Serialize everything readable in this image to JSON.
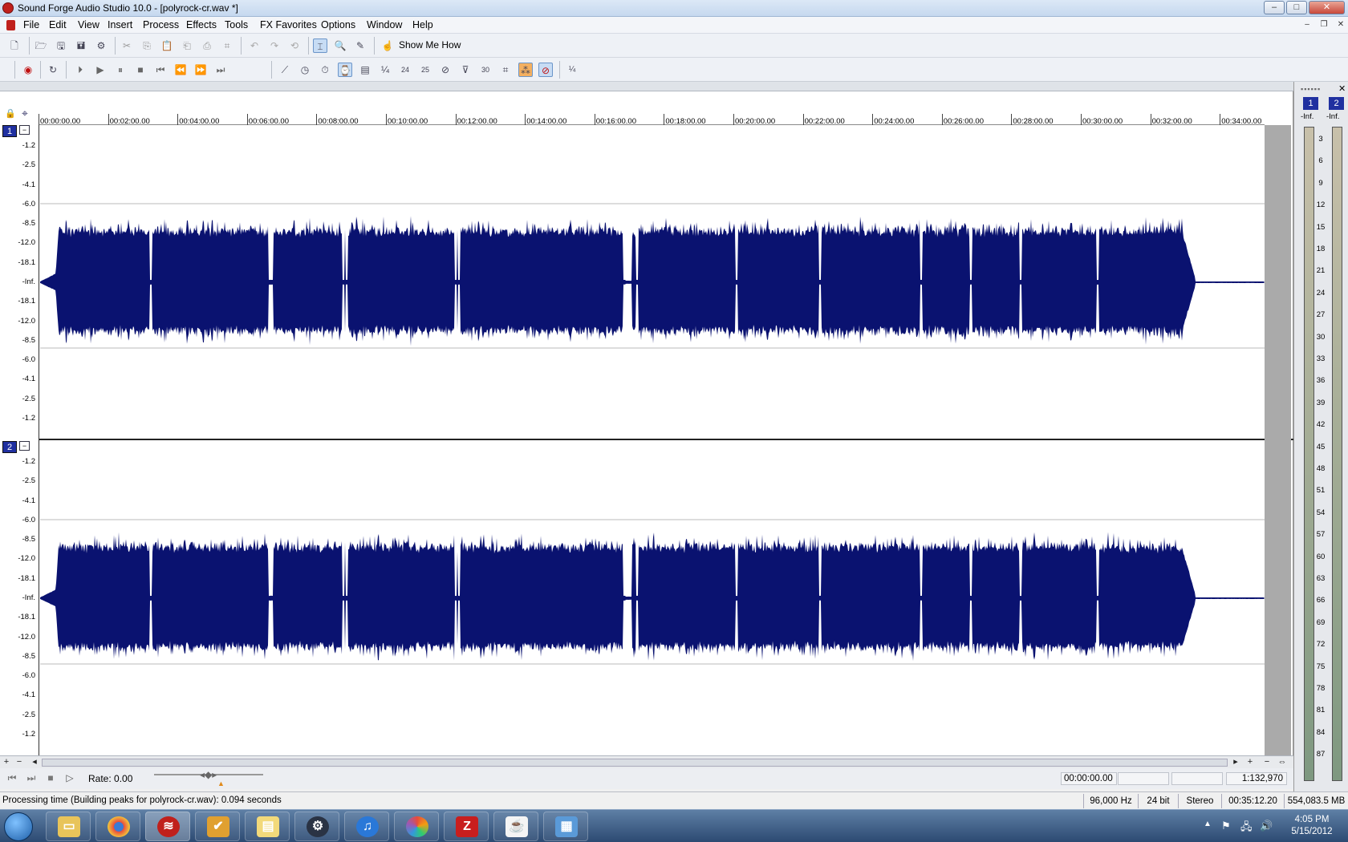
{
  "window": {
    "title": "Sound Forge Audio Studio 10.0 - [polyrock-cr.wav *]",
    "minimize": "–",
    "maximize": "□",
    "close": "✕"
  },
  "menu": {
    "items": [
      "File",
      "Edit",
      "View",
      "Insert",
      "Process",
      "Effects",
      "Tools",
      "FX Favorites",
      "Options",
      "Window",
      "Help"
    ]
  },
  "toolbar": {
    "show_me_how": "Show Me How",
    "icons": [
      "new-icon",
      "open-icon",
      "save-icon",
      "save-as-icon",
      "render-icon",
      "cut-icon",
      "copy-icon",
      "paste-icon",
      "paste-special-icon",
      "mix-icon",
      "crop-icon",
      "undo-icon",
      "redo-icon",
      "repeat-icon",
      "edit-tool-icon",
      "magnify-tool-icon",
      "pencil-tool-icon",
      "help-icon"
    ]
  },
  "transport_toolbar": {
    "icons": [
      "record-icon",
      "loop-icon",
      "play-all-icon",
      "play-icon",
      "pause-icon",
      "stop-icon",
      "go-start-icon",
      "rewind-icon",
      "forward-icon",
      "go-end-icon"
    ],
    "time_format": [
      "¼",
      "24",
      "25",
      "30"
    ]
  },
  "timeline": {
    "ticks": [
      "00:00:00.00",
      "00:02:00.00",
      "00:04:00.00",
      "00:06:00.00",
      "00:08:00.00",
      "00:10:00.00",
      "00:12:00.00",
      "00:14:00.00",
      "00:16:00.00",
      "00:18:00.00",
      "00:20:00.00",
      "00:22:00.00",
      "00:24:00.00",
      "00:26:00.00",
      "00:28:00.00",
      "00:30:00.00",
      "00:32:00.00",
      "00:34:00.00"
    ]
  },
  "channels": [
    {
      "badge": "1",
      "minimize": "−",
      "scale": [
        "-1.2",
        "-2.5",
        "-4.1",
        "-6.0",
        "-8.5",
        "-12.0",
        "-18.1",
        "-Inf.",
        "-18.1",
        "-12.0",
        "-8.5",
        "-6.0",
        "-4.1",
        "-2.5",
        "-1.2"
      ]
    },
    {
      "badge": "2",
      "minimize": "−",
      "scale": [
        "-1.2",
        "-2.5",
        "-4.1",
        "-6.0",
        "-8.5",
        "-12.0",
        "-18.1",
        "-Inf.",
        "-18.1",
        "-12.0",
        "-8.5",
        "-6.0",
        "-4.1",
        "-2.5",
        "-1.2"
      ]
    }
  ],
  "wave_color": "#0a1270",
  "transport": {
    "rate": "Rate: 0.00",
    "cursor_position": "00:00:00.00",
    "zoom_ratio": "1:132,970"
  },
  "status": {
    "message": "Processing time (Building peaks for polyrock-cr.wav): 0.094 seconds",
    "sample_rate": "96,000 Hz",
    "bit_depth": "24 bit",
    "channels": "Stereo",
    "length": "00:35:12.20",
    "free_space": "554,083.5 MB"
  },
  "meters": {
    "channels": [
      "1",
      "2"
    ],
    "top_label": "-Inf.",
    "scale": [
      "3",
      "6",
      "9",
      "12",
      "15",
      "18",
      "21",
      "24",
      "27",
      "30",
      "33",
      "36",
      "39",
      "42",
      "45",
      "48",
      "51",
      "54",
      "57",
      "60",
      "63",
      "66",
      "69",
      "72",
      "75",
      "78",
      "81",
      "84",
      "87"
    ]
  },
  "taskbar": {
    "apps": [
      "explorer-icon",
      "chrome-icon",
      "sound-forge-icon",
      "tasks-icon",
      "folders-icon",
      "steam-icon",
      "itunes-icon",
      "picasa-icon",
      "filezilla-icon",
      "java-icon",
      "photo-viewer-icon"
    ],
    "time": "4:05 PM",
    "date": "5/15/2012"
  }
}
